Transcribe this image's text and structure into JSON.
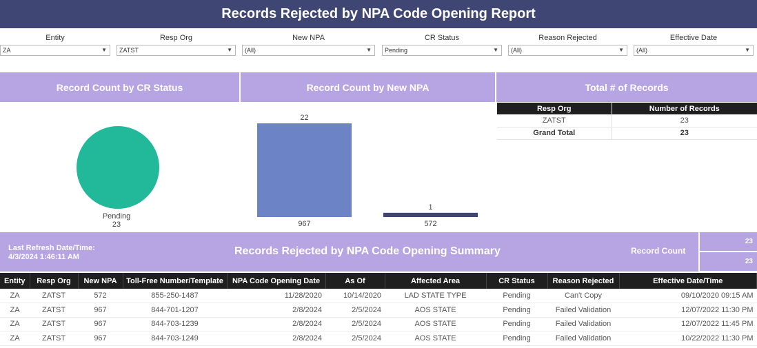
{
  "report_title": "Records Rejected by NPA Code Opening Report",
  "filters": [
    {
      "label": "Entity",
      "value": "ZA"
    },
    {
      "label": "Resp Org",
      "value": "ZATST"
    },
    {
      "label": "New NPA",
      "value": "(All)"
    },
    {
      "label": "CR Status",
      "value": "Pending"
    },
    {
      "label": "Reason Rejected",
      "value": "(All)"
    },
    {
      "label": "Effective Date",
      "value": "(All)"
    }
  ],
  "panels": {
    "cr_status_title": "Record Count by CR Status",
    "new_npa_title": "Record Count by New NPA",
    "total_title": "Total # of Records"
  },
  "colors": {
    "header_bg": "#3f4673",
    "panel_bg": "#b7a4e3",
    "pie_pending": "#21b99a",
    "bar_967": "#6c84c6",
    "bar_572": "#3f4673"
  },
  "chart_data": [
    {
      "type": "pie",
      "title": "Record Count by CR Status",
      "categories": [
        "Pending"
      ],
      "values": [
        23
      ]
    },
    {
      "type": "bar",
      "title": "Record Count by New NPA",
      "categories": [
        "967",
        "572"
      ],
      "values": [
        22,
        1
      ]
    }
  ],
  "totals_table": {
    "headers": [
      "Resp Org",
      "Number of Records"
    ],
    "rows": [
      [
        "ZATST",
        "23"
      ]
    ],
    "grand_total_label": "Grand Total",
    "grand_total_value": "23"
  },
  "summary": {
    "refresh_label": "Last Refresh Date/Time:",
    "refresh_value": "4/3/2024 1:46:11 AM",
    "title": "Records Rejected by NPA Code Opening Summary",
    "record_count_label": "Record Count",
    "record_count_values": [
      "23",
      "23"
    ]
  },
  "records_table": {
    "headers": [
      "Entity",
      "Resp Org",
      "New NPA",
      "Toll-Free Number/Template",
      "NPA Code Opening Date",
      "As Of",
      "Affected Area",
      "CR Status",
      "Reason Rejected",
      "Effective Date/Time"
    ],
    "rows": [
      [
        "ZA",
        "ZATST",
        "572",
        "855-250-1487",
        "11/28/2020",
        "10/14/2020",
        "LAD STATE TYPE",
        "Pending",
        "Can't Copy",
        "09/10/2020 09:15 AM"
      ],
      [
        "ZA",
        "ZATST",
        "967",
        "844-701-1207",
        "2/8/2024",
        "2/5/2024",
        "AOS STATE",
        "Pending",
        "Failed Validation",
        "12/07/2022 11:30 PM"
      ],
      [
        "ZA",
        "ZATST",
        "967",
        "844-703-1239",
        "2/8/2024",
        "2/5/2024",
        "AOS STATE",
        "Pending",
        "Failed Validation",
        "12/07/2022 11:45 PM"
      ],
      [
        "ZA",
        "ZATST",
        "967",
        "844-703-1249",
        "2/8/2024",
        "2/5/2024",
        "AOS STATE",
        "Pending",
        "Failed Validation",
        "10/22/2022 11:30 PM"
      ]
    ]
  }
}
